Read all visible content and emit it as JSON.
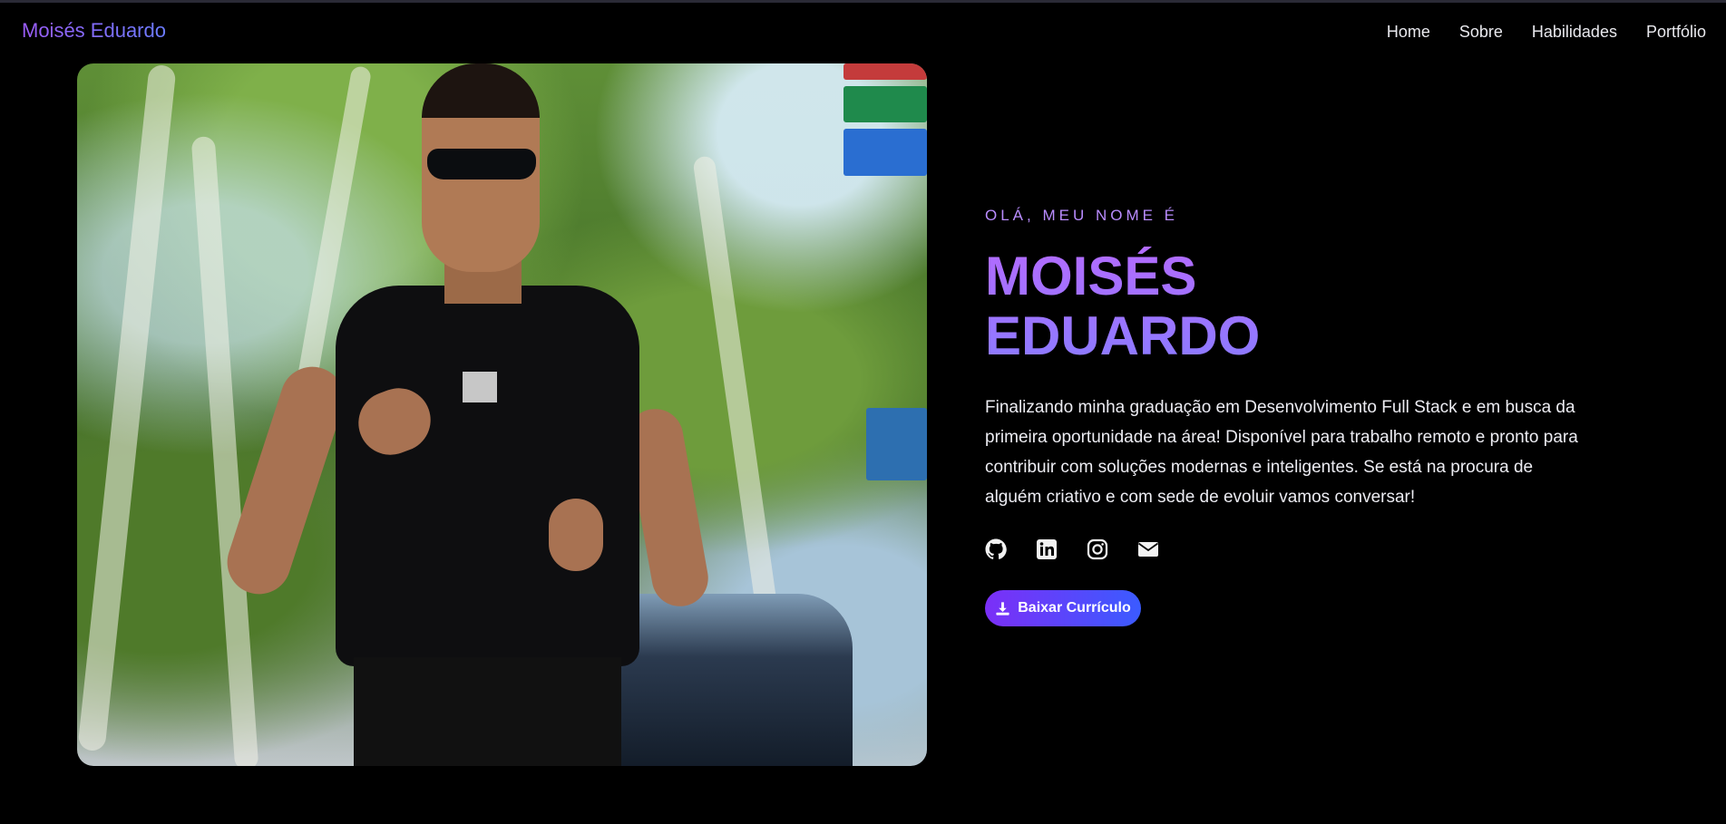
{
  "header": {
    "brand": "Moisés Eduardo",
    "nav": [
      "Home",
      "Sobre",
      "Habilidades",
      "Portfólio"
    ]
  },
  "hero": {
    "eyebrow": "OLÁ, MEU NOME É",
    "name_line1": "MOISÉS",
    "name_line2": "EDUARDO",
    "description": "Finalizando minha graduação em Desenvolvimento Full Stack e em busca da primeira oportunidade na área! Disponível para trabalho remoto e pronto para contribuir com soluções modernas e inteligentes. Se está na procura de alguém criativo e com sede de evoluir vamos conversar!",
    "socials": [
      "github-icon",
      "linkedin-icon",
      "instagram-icon",
      "email-icon"
    ],
    "cv_button": "Baixar Currículo",
    "cv_icon": "download-icon"
  },
  "colors": {
    "background": "#000000",
    "accent_purple": "#9b5cf6",
    "accent_blue": "#3b5bff",
    "eyebrow": "#b98cff"
  }
}
